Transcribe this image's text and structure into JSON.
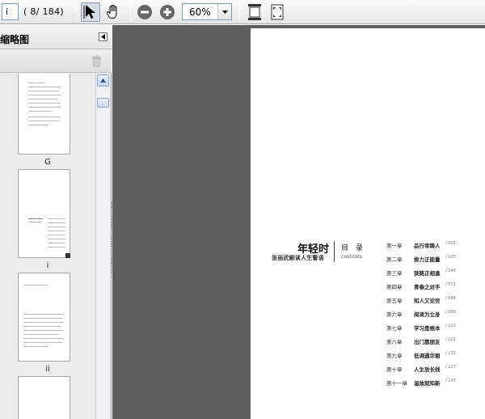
{
  "toolbar": {
    "page_value": "i",
    "page_count": "( 8/ 184)",
    "zoom_value": "60%",
    "icons": [
      "select-tool-icon",
      "hand-tool-icon",
      "zoom-out-icon",
      "zoom-in-icon",
      "fit-width-icon",
      "fit-page-icon"
    ]
  },
  "panel": {
    "title": "缩略图",
    "thumbnails": [
      {
        "label": "G"
      },
      {
        "label": "i",
        "selected": true
      },
      {
        "label": "ii"
      },
      {
        "label": ""
      }
    ]
  },
  "page": {
    "book_title": "年轻时",
    "book_subtitle": "张丽武解读人生警语",
    "mulu": "目 录",
    "contents": "contents",
    "toc": [
      {
        "chapter": "第一章",
        "title": "品行幸踌人",
        "page": "/ 001"
      },
      {
        "chapter": "第二章",
        "title": "挨力正能量",
        "page": "/ 025"
      },
      {
        "chapter": "第三章",
        "title": "狭路正相逢",
        "page": "/ 048"
      },
      {
        "chapter": "第四章",
        "title": "青春之对手",
        "page": "/ 071"
      },
      {
        "chapter": "第五章",
        "title": "知人又论世",
        "page": "/ 088"
      },
      {
        "chapter": "第六章",
        "title": "阅读为立身",
        "page": "/ 099"
      },
      {
        "chapter": "第七章",
        "title": "学习是根本",
        "page": "/ 113"
      },
      {
        "chapter": "第八章",
        "title": "出门靠朋友",
        "page": "/ 121"
      },
      {
        "chapter": "第九章",
        "title": "低调遇华丽",
        "page": "/ 131"
      },
      {
        "chapter": "第十章",
        "title": "人生放长线",
        "page": "/ 137"
      },
      {
        "chapter": "第十一章",
        "title": "温故就知新",
        "page": "/ 145"
      }
    ]
  }
}
